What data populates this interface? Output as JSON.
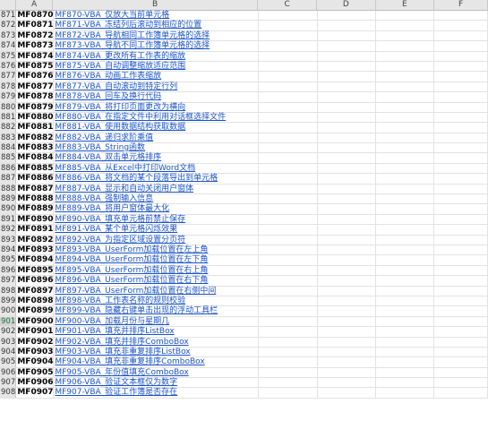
{
  "columns": [
    "A",
    "B",
    "C",
    "D",
    "E",
    "F"
  ],
  "rows": [
    {
      "n": "871",
      "a": "MF0870",
      "b": "MF870-VBA_仅放大当前单元格"
    },
    {
      "n": "872",
      "a": "MF0871",
      "b": "MF871-VBA_冻结列后滚动到相应的位置"
    },
    {
      "n": "873",
      "a": "MF0872",
      "b": "MF872-VBA_导航相同工作簿单元格的选择"
    },
    {
      "n": "874",
      "a": "MF0873",
      "b": "MF873-VBA_导航不同工作簿单元格的选择"
    },
    {
      "n": "875",
      "a": "MF0874",
      "b": "MF874-VBA_更改所有工作表的缩放"
    },
    {
      "n": "876",
      "a": "MF0875",
      "b": "MF875-VBA_自动调整缩放适应范围"
    },
    {
      "n": "877",
      "a": "MF0876",
      "b": "MF876-VBA_动画工作表缩放"
    },
    {
      "n": "878",
      "a": "MF0877",
      "b": "MF877-VBA_自动滚动到特定行列"
    },
    {
      "n": "879",
      "a": "MF0878",
      "b": "MF878-VBA_回车及换行代码"
    },
    {
      "n": "880",
      "a": "MF0879",
      "b": "MF879-VBA_将打印页面更改为横向"
    },
    {
      "n": "881",
      "a": "MF0880",
      "b": "MF880-VBA_在指定文件中利用对话框选择文件"
    },
    {
      "n": "882",
      "a": "MF0881",
      "b": "MF881-VBA_使用数据结构获取数据"
    },
    {
      "n": "883",
      "a": "MF0882",
      "b": "MF882-VBA_递归求阶乘值"
    },
    {
      "n": "884",
      "a": "MF0883",
      "b": "MF883-VBA_String函数"
    },
    {
      "n": "885",
      "a": "MF0884",
      "b": "MF884-VBA_双击单元格排序"
    },
    {
      "n": "886",
      "a": "MF0885",
      "b": "MF885-VBA_从Excel中打印Word文档"
    },
    {
      "n": "887",
      "a": "MF0886",
      "b": "MF886-VBA_将文档的某个段落导出到单元格"
    },
    {
      "n": "888",
      "a": "MF0887",
      "b": "MF887-VBA_显示和自动关闭用户窗体"
    },
    {
      "n": "889",
      "a": "MF0888",
      "b": "MF888-VBA_强制输入信息"
    },
    {
      "n": "890",
      "a": "MF0889",
      "b": "MF889-VBA_将用户窗体最大化"
    },
    {
      "n": "891",
      "a": "MF0890",
      "b": "MF890-VBA_填充单元格前禁止保存"
    },
    {
      "n": "892",
      "a": "MF0891",
      "b": "MF891-VBA_某个单元格闪烁效果"
    },
    {
      "n": "893",
      "a": "MF0892",
      "b": "MF892-VBA_为指定区域设置分页符"
    },
    {
      "n": "894",
      "a": "MF0893",
      "b": "MF893-VBA_UserForm加载位置在左上角"
    },
    {
      "n": "895",
      "a": "MF0894",
      "b": "MF894-VBA_UserForm加载位置在左下角"
    },
    {
      "n": "896",
      "a": "MF0895",
      "b": "MF895-VBA_UserForm加载位置在右上角"
    },
    {
      "n": "897",
      "a": "MF0896",
      "b": "MF896-VBA_UserForm加载位置在右下角"
    },
    {
      "n": "898",
      "a": "MF0897",
      "b": "MF897-VBA_UserForm加载位置在右侧中间"
    },
    {
      "n": "899",
      "a": "MF0898",
      "b": "MF898-VBA_工作表名称的规则校验"
    },
    {
      "n": "900",
      "a": "MF0899",
      "b": "MF899-VBA_隐藏右键单击出现的浮动工具栏"
    },
    {
      "n": "901",
      "a": "MF0900",
      "b": "MF900-VBA_加载月份与星期几"
    },
    {
      "n": "902",
      "a": "MF0901",
      "b": "MF901-VBA_填充并排序ListBox"
    },
    {
      "n": "903",
      "a": "MF0902",
      "b": "MF902-VBA_填充并排序ComboBox"
    },
    {
      "n": "904",
      "a": "MF0903",
      "b": "MF903-VBA_填充非重复排序ListBox"
    },
    {
      "n": "905",
      "a": "MF0904",
      "b": "MF904-VBA_填充非重复排序ComboBox"
    },
    {
      "n": "906",
      "a": "MF0905",
      "b": "MF905-VBA_年份值填充ComboBox"
    },
    {
      "n": "907",
      "a": "MF0906",
      "b": "MF906-VBA_验证文本框仅为数字"
    },
    {
      "n": "908",
      "a": "MF0907",
      "b": "MF907-VBA_验证工作簿是否存在"
    }
  ],
  "selected_row": "901"
}
